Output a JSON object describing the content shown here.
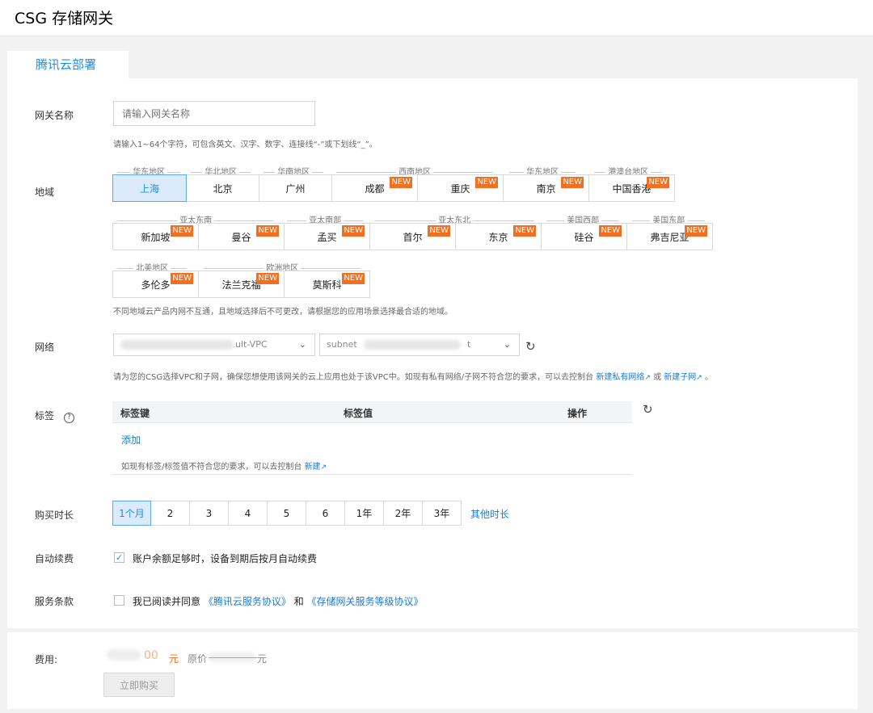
{
  "page": {
    "title": "CSG 存储网关",
    "tab": "腾讯云部署"
  },
  "gateway_name": {
    "label": "网关名称",
    "placeholder": "请输入网关名称",
    "hint": "请输入1~64个字符，可包含英文、汉字、数字、连接线“-”或下划线“_”。"
  },
  "region": {
    "label": "地域",
    "groups": {
      "east": "华东地区",
      "north": "华北地区",
      "south": "华南地区",
      "southwest": "西南地区",
      "east2": "华东地区",
      "hmt": "港澳台地区",
      "sea": "亚太东南",
      "sa": "亚太南部",
      "nea": "亚太东北",
      "usw": "美国西部",
      "use": "美国东部",
      "na": "北美地区",
      "eu": "欧洲地区"
    },
    "rows": [
      [
        {
          "name": "上海",
          "new": false,
          "selected": true
        },
        {
          "name": "北京",
          "new": false
        },
        {
          "name": "广州",
          "new": false
        },
        {
          "name": "成都",
          "new": true
        },
        {
          "name": "重庆",
          "new": true
        },
        {
          "name": "南京",
          "new": true
        },
        {
          "name": "中国香港",
          "new": true
        }
      ],
      [
        {
          "name": "新加坡",
          "new": true
        },
        {
          "name": "曼谷",
          "new": true
        },
        {
          "name": "孟买",
          "new": true
        },
        {
          "name": "首尔",
          "new": true
        },
        {
          "name": "东京",
          "new": true
        },
        {
          "name": "硅谷",
          "new": true
        },
        {
          "name": "弗吉尼亚",
          "new": true
        }
      ],
      [
        {
          "name": "多伦多",
          "new": true
        },
        {
          "name": "法兰克福",
          "new": true
        },
        {
          "name": "莫斯科",
          "new": true
        }
      ]
    ],
    "new_badge": "NEW",
    "hint": "不同地域云产品内网不互通，且地域选择后不可更改，请根据您的应用场景选择最合适的地域。"
  },
  "network": {
    "label": "网络",
    "vpc_tail": "ult-VPC",
    "subnet_head": "subnet",
    "subnet_tail": "t",
    "hint": "请为您的CSG选择VPC和子网，确保您想使用该网关的云上应用也处于该VPC中。如现有私有网络/子网不符合您的要求，可以去控制台",
    "link_vpc": "新建私有网络",
    "or": "或",
    "link_subnet": "新建子网",
    "end": "。"
  },
  "tags": {
    "label": "标签",
    "col_key": "标签键",
    "col_value": "标签值",
    "col_action": "操作",
    "add": "添加",
    "hint": "如现有标签/标签值不符合您的要求，可以去控制台",
    "link_new": "新建"
  },
  "duration": {
    "label": "购买时长",
    "options": [
      "1个月",
      "2",
      "3",
      "4",
      "5",
      "6",
      "1年",
      "2年",
      "3年"
    ],
    "selected_index": 0,
    "other": "其他时长"
  },
  "auto_renew": {
    "label": "自动续费",
    "checked": true,
    "text": "账户余额足够时，设备到期后按月自动续费"
  },
  "terms": {
    "label": "服务条款",
    "checked": false,
    "prefix": "我已阅读并同意",
    "link1": "《腾讯云服务协议》",
    "and": "和",
    "link2": "《存储网关服务等级协议》"
  },
  "footer": {
    "fee_label": "费用:",
    "price_digits": "00",
    "currency": "元",
    "original_label": "原价",
    "original_currency": "元",
    "buy_label": "立即购买"
  },
  "colors": {
    "accent": "#1d8fe8",
    "badge": "#f26f22",
    "link": "#1a7bd6"
  },
  "icons": [
    "refresh-icon",
    "help-icon",
    "chevron-down-icon",
    "external-link-icon",
    "check-icon"
  ]
}
